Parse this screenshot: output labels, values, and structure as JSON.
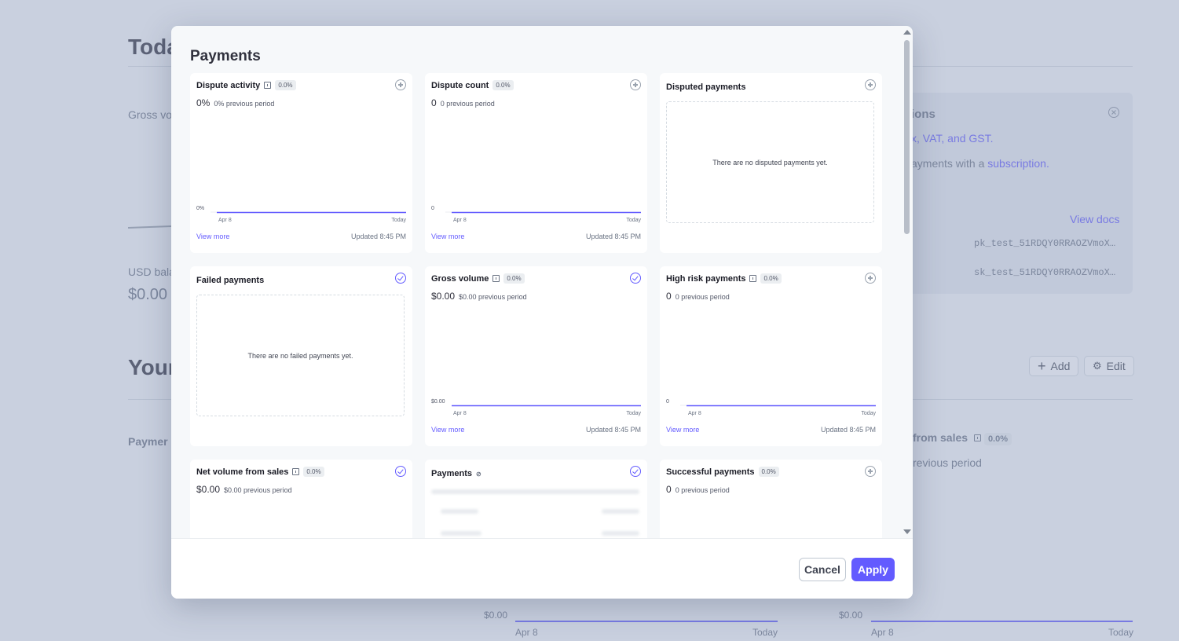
{
  "background": {
    "heading_today": "Toda",
    "gross_volume_label": "Gross vo",
    "usd_balance_label": "USD bala",
    "usd_balance_value": "$0.00",
    "heading_your": "Your",
    "payments_label": "Paymer",
    "info_card": {
      "title": "ions",
      "line1": "x, VAT, and GST.",
      "line2_prefix": "ayments with a ",
      "line2_link": "subscription.",
      "view_docs": "View docs",
      "pk_key": "pk_test_51RDQY0RRAOZVmoX…",
      "sk_key": "sk_test_51RDQY0RRAOZVmoX…"
    },
    "add_button": "Add",
    "edit_button": "Edit",
    "net_volume_label": "from sales",
    "net_volume_badge": "0.0%",
    "previous_period": "revious period",
    "chart1": {
      "y_label": "$0.00",
      "start": "Apr 8",
      "end": "Today"
    },
    "chart2": {
      "y_label": "$0.00",
      "start": "Apr 8",
      "end": "Today"
    }
  },
  "modal": {
    "title": "Payments",
    "cancel_label": "Cancel",
    "apply_label": "Apply",
    "widgets": [
      {
        "title": "Dispute activity",
        "badge": "0.0%",
        "value": "0%",
        "previous": "0% previous period",
        "y_zero": "0%",
        "start": "Apr 8",
        "end": "Today",
        "view_more": "View more",
        "updated": "Updated 8:45 PM",
        "status": "add"
      },
      {
        "title": "Dispute count",
        "badge": "0.0%",
        "value": "0",
        "previous": "0 previous period",
        "y_zero": "0",
        "start": "Apr 8",
        "end": "Today",
        "view_more": "View more",
        "updated": "Updated 8:45 PM",
        "status": "add"
      },
      {
        "title": "Disputed payments",
        "empty_message": "There are no disputed payments yet.",
        "status": "add"
      },
      {
        "title": "Failed payments",
        "empty_message": "There are no failed payments yet.",
        "status": "selected"
      },
      {
        "title": "Gross volume",
        "badge": "0.0%",
        "value": "$0.00",
        "previous": "$0.00 previous period",
        "y_zero": "$0.00",
        "start": "Apr 8",
        "end": "Today",
        "view_more": "View more",
        "updated": "Updated 8:45 PM",
        "status": "selected"
      },
      {
        "title": "High risk payments",
        "badge": "0.0%",
        "value": "0",
        "previous": "0 previous period",
        "y_zero": "0",
        "start": "Apr 8",
        "end": "Today",
        "view_more": "View more",
        "updated": "Updated 8:45 PM",
        "status": "add"
      },
      {
        "title": "Net volume from sales",
        "badge": "0.0%",
        "value": "$0.00",
        "previous": "$0.00 previous period",
        "status": "selected"
      },
      {
        "title": "Payments",
        "status": "selected"
      },
      {
        "title": "Successful payments",
        "badge": "0.0%",
        "value": "0",
        "previous": "0 previous period",
        "status": "add"
      }
    ]
  },
  "colors": {
    "accent": "#635bff",
    "overlay": "#92a0be"
  },
  "icons": [
    "plus-circle-icon",
    "check-circle-icon",
    "info-icon",
    "gear-icon",
    "close-circle-icon",
    "scroll-up-icon",
    "scroll-down-icon"
  ]
}
